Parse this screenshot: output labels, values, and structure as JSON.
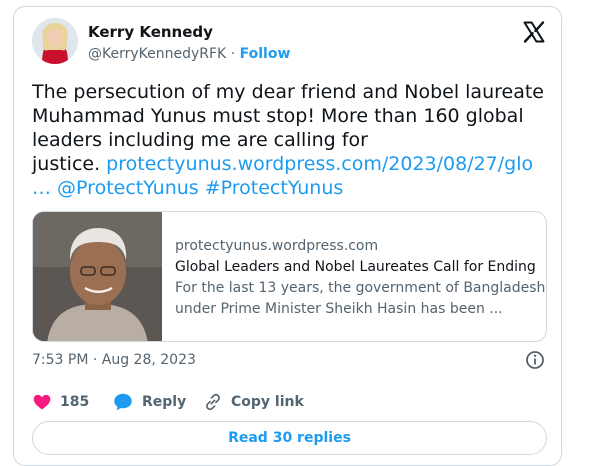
{
  "author": {
    "name": "Kerry Kennedy",
    "handle": "@KerryKennedyRFK",
    "separator": "·",
    "follow_label": "Follow"
  },
  "tweet": {
    "line1": "The persecution of my dear friend and Nobel laureate",
    "line2": "Muhammad Yunus must stop! More than 160 global",
    "line3": "leaders including me are calling for",
    "line4_text": "justice. ",
    "line4_link": "protectyunus.wordpress.com/2023/08/27/glo",
    "line5_ellipsis": "…",
    "mention": "@ProtectYunus",
    "hashtag": "#ProtectYunus"
  },
  "link_card": {
    "domain": "protectyunus.wordpress.com",
    "title": "Global Leaders and Nobel Laureates Call for Ending ...",
    "description_line1": "For the last 13 years, the government of Bangladesh",
    "description_line2": "under Prime Minister Sheikh Hasin has been ..."
  },
  "timestamp": "7:53 PM · Aug 28, 2023",
  "actions": {
    "likes_count": "185",
    "reply_label": "Reply",
    "copy_link_label": "Copy link"
  },
  "read_replies_label": "Read 30 replies",
  "icons": {
    "x_logo": "x-logo-icon",
    "info": "info-icon",
    "heart": "heart-icon",
    "reply": "speech-bubble-icon",
    "link": "chain-link-icon"
  },
  "colors": {
    "accent": "#1d9bf0",
    "like": "#f91880",
    "text": "#0f1419",
    "muted": "#536471",
    "border": "#cfd9de"
  }
}
